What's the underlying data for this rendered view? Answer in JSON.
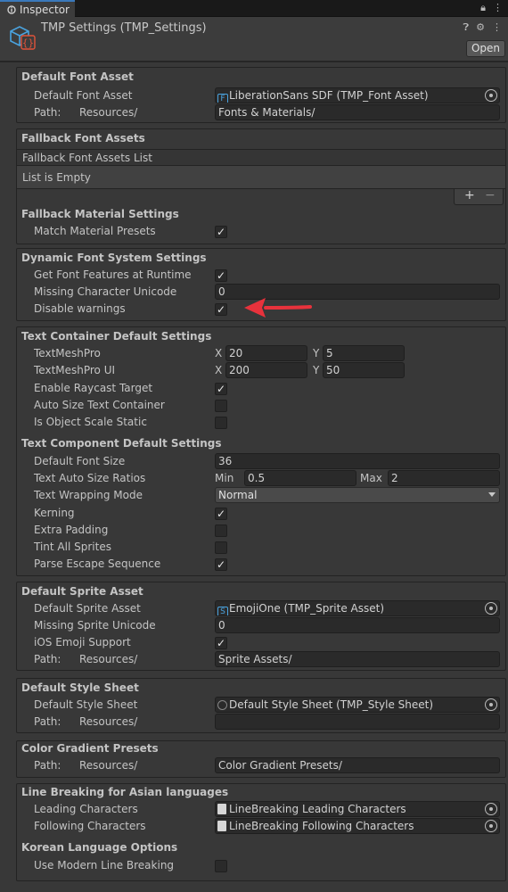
{
  "tab": {
    "label": "Inspector"
  },
  "header": {
    "title": "TMP Settings (TMP_Settings)",
    "open_label": "Open"
  },
  "default_font_asset": {
    "heading": "Default Font Asset",
    "asset_label": "Default Font Asset",
    "asset_value": "LiberationSans SDF (TMP_Font Asset)",
    "path_label": "Path:",
    "path_prefix": "Resources/",
    "path_value": "Fonts & Materials/"
  },
  "fallback_font_assets": {
    "heading": "Fallback Font Assets",
    "list_label": "Fallback Font Assets List",
    "empty_text": "List is Empty",
    "add_label": "+",
    "remove_label": "−",
    "material_heading": "Fallback Material Settings",
    "match_presets_label": "Match Material Presets",
    "match_presets_checked": true
  },
  "dynamic_font": {
    "heading": "Dynamic Font System Settings",
    "get_features_label": "Get Font Features at Runtime",
    "get_features_checked": true,
    "missing_char_label": "Missing Character Unicode",
    "missing_char_value": "0",
    "disable_warnings_label": "Disable warnings",
    "disable_warnings_checked": true
  },
  "text_container": {
    "heading": "Text Container Default Settings",
    "tmp_label": "TextMeshPro",
    "tmp_x": "20",
    "tmp_y": "5",
    "tmp_ui_label": "TextMeshPro UI",
    "tmp_ui_x": "200",
    "tmp_ui_y": "50",
    "x_label": "X",
    "y_label": "Y",
    "raycast_label": "Enable Raycast Target",
    "raycast_checked": true,
    "autosize_label": "Auto Size Text Container",
    "autosize_checked": false,
    "scale_static_label": "Is Object Scale Static",
    "scale_static_checked": false
  },
  "text_component": {
    "heading": "Text Component Default Settings",
    "font_size_label": "Default Font Size",
    "font_size_value": "36",
    "auto_size_label": "Text Auto Size Ratios",
    "min_label": "Min",
    "min_value": "0.5",
    "max_label": "Max",
    "max_value": "2",
    "wrapping_label": "Text Wrapping Mode",
    "wrapping_value": "Normal",
    "kerning_label": "Kerning",
    "kerning_checked": true,
    "extra_padding_label": "Extra Padding",
    "extra_padding_checked": false,
    "tint_label": "Tint All Sprites",
    "tint_checked": false,
    "escape_label": "Parse Escape Sequence",
    "escape_checked": true
  },
  "sprite_asset": {
    "heading": "Default Sprite Asset",
    "asset_label": "Default Sprite Asset",
    "asset_value": "EmojiOne (TMP_Sprite Asset)",
    "missing_label": "Missing Sprite Unicode",
    "missing_value": "0",
    "ios_label": "iOS Emoji Support",
    "ios_checked": true,
    "path_label": "Path:",
    "path_prefix": "Resources/",
    "path_value": "Sprite Assets/"
  },
  "style_sheet": {
    "heading": "Default Style Sheet",
    "asset_label": "Default Style Sheet",
    "asset_value": "Default Style Sheet (TMP_Style Sheet)",
    "path_label": "Path:",
    "path_prefix": "Resources/",
    "path_value": ""
  },
  "color_gradient": {
    "heading": "Color Gradient Presets",
    "path_label": "Path:",
    "path_prefix": "Resources/",
    "path_value": "Color Gradient Presets/"
  },
  "line_breaking": {
    "heading": "Line Breaking for Asian languages",
    "leading_label": "Leading Characters",
    "leading_value": "LineBreaking Leading Characters",
    "following_label": "Following Characters",
    "following_value": "LineBreaking Following Characters",
    "korean_heading": "Korean Language Options",
    "modern_label": "Use Modern Line Breaking",
    "modern_checked": false
  },
  "icons": {
    "tab": "inspector-icon",
    "header": "tmp-settings-asset-icon",
    "lock": "lock-icon",
    "menu": "kebab-menu-icon",
    "help": "help-icon",
    "settings": "preset-settings-icon",
    "annotation": "red-arrow-annotation"
  },
  "colors": {
    "accent": "#3a79bb",
    "annotation": "#e8323c",
    "field_bg": "#2a2a2a",
    "panel_bg": "#383838"
  }
}
